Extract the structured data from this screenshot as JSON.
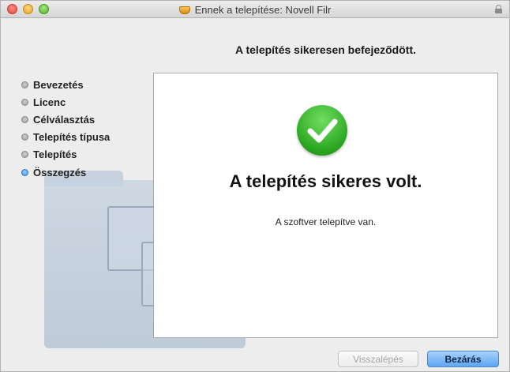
{
  "window": {
    "title": "Ennek a telepítése: Novell Filr"
  },
  "heading": "A telepítés sikeresen befejeződött.",
  "steps": [
    {
      "label": "Bevezetés",
      "active": false
    },
    {
      "label": "Licenc",
      "active": false
    },
    {
      "label": "Célválasztás",
      "active": false
    },
    {
      "label": "Telepítés típusa",
      "active": false
    },
    {
      "label": "Telepítés",
      "active": false
    },
    {
      "label": "Összegzés",
      "active": true
    }
  ],
  "content": {
    "title": "A telepítés sikeres volt.",
    "message": "A szoftver telepítve van."
  },
  "buttons": {
    "back": "Visszalépés",
    "close": "Bezárás"
  },
  "colors": {
    "active_step": "#3b8ee8",
    "success_green": "#2aa520",
    "primary_button": "#5da6f2"
  },
  "icons": [
    "package-icon",
    "lock-icon",
    "checkmark-icon",
    "folder-icon",
    "document-icon"
  ]
}
